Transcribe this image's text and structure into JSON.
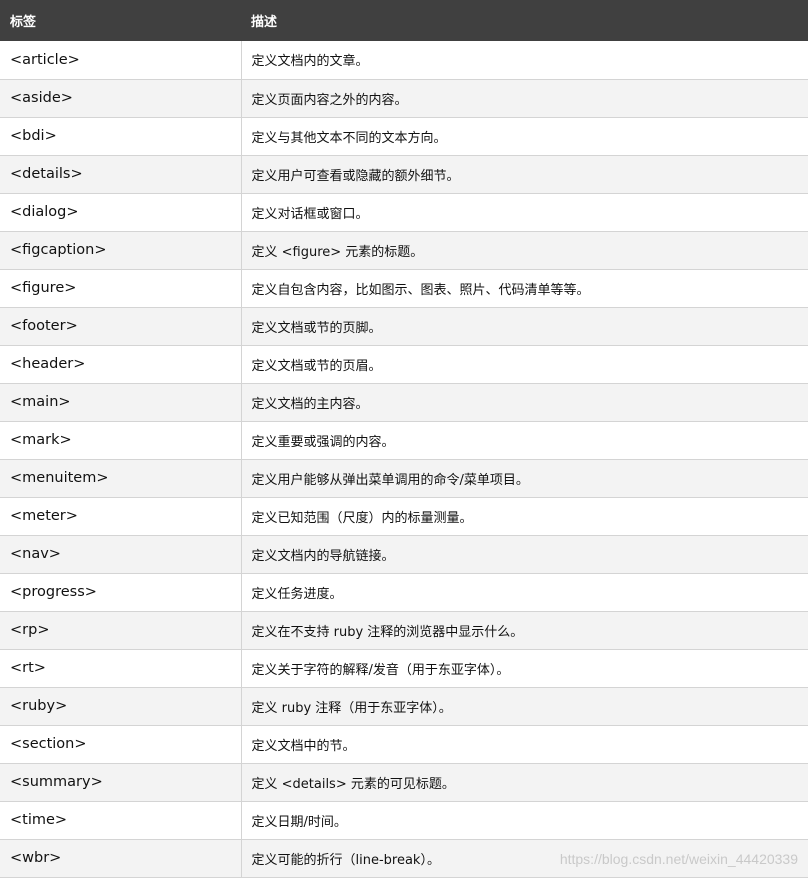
{
  "table": {
    "headers": [
      "标签",
      "描述"
    ],
    "rows": [
      {
        "tag": "<article>",
        "desc": "定义文档内的文章。"
      },
      {
        "tag": "<aside>",
        "desc": "定义页面内容之外的内容。"
      },
      {
        "tag": "<bdi>",
        "desc": "定义与其他文本不同的文本方向。"
      },
      {
        "tag": "<details>",
        "desc": "定义用户可查看或隐藏的额外细节。"
      },
      {
        "tag": "<dialog>",
        "desc": "定义对话框或窗口。"
      },
      {
        "tag": "<figcaption>",
        "desc": "定义 <figure> 元素的标题。"
      },
      {
        "tag": "<figure>",
        "desc": "定义自包含内容，比如图示、图表、照片、代码清单等等。"
      },
      {
        "tag": "<footer>",
        "desc": "定义文档或节的页脚。"
      },
      {
        "tag": "<header>",
        "desc": "定义文档或节的页眉。"
      },
      {
        "tag": "<main>",
        "desc": "定义文档的主内容。"
      },
      {
        "tag": "<mark>",
        "desc": "定义重要或强调的内容。"
      },
      {
        "tag": "<menuitem>",
        "desc": "定义用户能够从弹出菜单调用的命令/菜单项目。"
      },
      {
        "tag": "<meter>",
        "desc": "定义已知范围（尺度）内的标量测量。"
      },
      {
        "tag": "<nav>",
        "desc": "定义文档内的导航链接。"
      },
      {
        "tag": "<progress>",
        "desc": "定义任务进度。"
      },
      {
        "tag": "<rp>",
        "desc": "定义在不支持 ruby 注释的浏览器中显示什么。"
      },
      {
        "tag": "<rt>",
        "desc": "定义关于字符的解释/发音（用于东亚字体）。"
      },
      {
        "tag": "<ruby>",
        "desc": "定义 ruby 注释（用于东亚字体）。"
      },
      {
        "tag": "<section>",
        "desc": "定义文档中的节。"
      },
      {
        "tag": "<summary>",
        "desc": "定义 <details> 元素的可见标题。"
      },
      {
        "tag": "<time>",
        "desc": "定义日期/时间。"
      },
      {
        "tag": "<wbr>",
        "desc": "定义可能的折行（line-break）。"
      }
    ]
  },
  "watermark": "https://blog.csdn.net/weixin_44420339"
}
